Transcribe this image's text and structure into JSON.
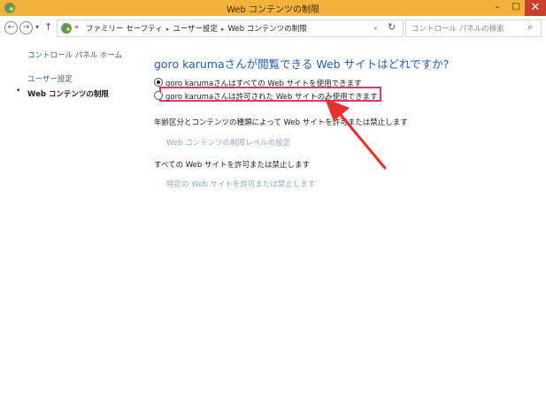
{
  "window": {
    "title": "Web コンテンツの制限",
    "minimize_label": "–",
    "maximize_label": "□",
    "close_label": "✕"
  },
  "address_bar": {
    "prefix": "«",
    "breadcrumbs": [
      "ファミリー セーフティ",
      "ユーザー設定",
      "Web コンテンツの制限"
    ]
  },
  "search": {
    "placeholder": "コントロール パネルの検索"
  },
  "sidebar": {
    "home_link": "コントロール パネル ホーム",
    "user_settings_link": "ユーザー設定",
    "current_item": "Web コンテンツの制限"
  },
  "main": {
    "heading": "goro karumaさんが閲覧できる Web サイトはどれですか?",
    "options": [
      {
        "label": "goro karumaさんはすべての Web サイトを使用できます",
        "checked": true
      },
      {
        "label": "goro karumaさんは許可された Web サイトのみ使用できます",
        "checked": false
      }
    ],
    "section1_heading": "年齢区分とコンテンツの種類によって Web サイトを許可または禁止します",
    "section1_link": "Web コンテンツの制限レベルの設定",
    "section2_heading": "すべての Web サイトを許可または禁止します",
    "section2_link": "特定の Web サイトを許可または禁止します"
  },
  "colors": {
    "titlebar": "#f2b33d",
    "close_button": "#c7402f",
    "heading_blue": "#1e5eb5",
    "annotation_pink": "#e8316f",
    "annotation_arrow": "#e8302c"
  }
}
